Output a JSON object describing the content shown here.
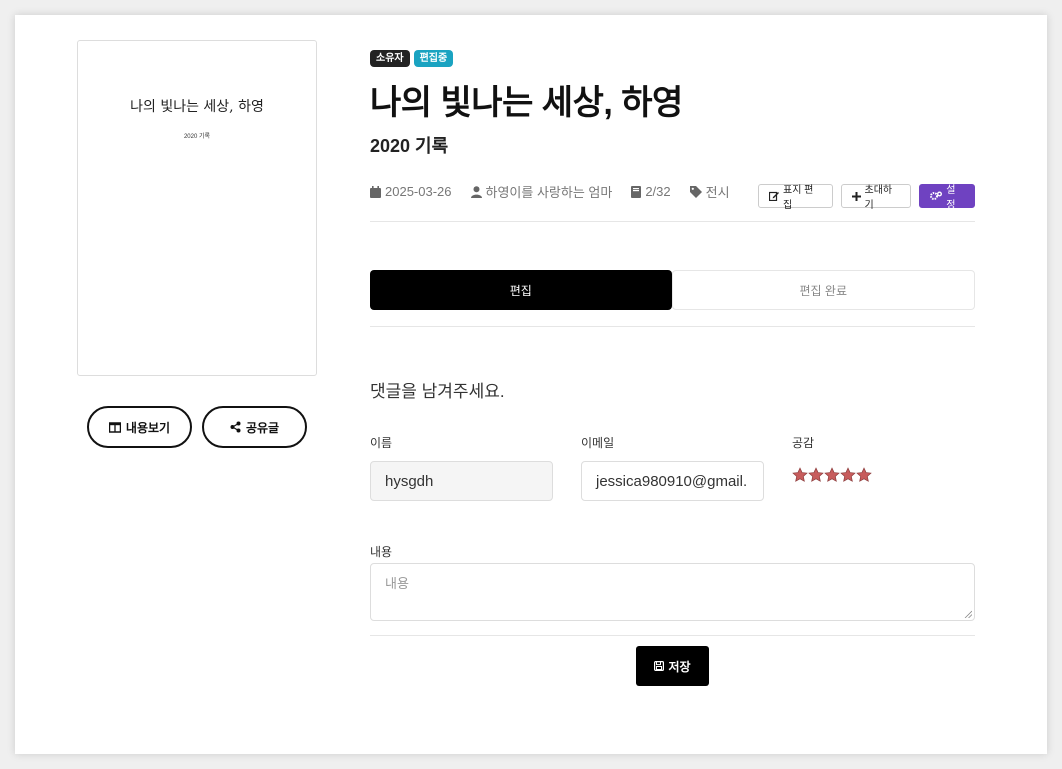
{
  "cover": {
    "title": "나의 빛나는 세상, 하영",
    "subtitle": "2020 기록"
  },
  "left_buttons": {
    "view_label": "내용보기",
    "share_label": "공유글"
  },
  "badges": {
    "owner": "소유자",
    "editing": "편집중"
  },
  "book": {
    "title": "나의 빛나는 세상, 하영",
    "subtitle": "2020 기록",
    "date": "2025-03-26",
    "author": "하영이를 사랑하는 엄마",
    "pages": "2/32",
    "tag": "전시"
  },
  "actions": {
    "edit_cover": "표지 편집",
    "invite": "초대하기",
    "settings": "설정"
  },
  "tabs": [
    {
      "label": "편집",
      "active": true
    },
    {
      "label": "편집 완료",
      "active": false
    }
  ],
  "comment": {
    "heading": "댓글을 남겨주세요.",
    "name_label": "이름",
    "name_value": "hysgdh",
    "email_label": "이메일",
    "email_value": "jessica980910@gmail.",
    "rating_label": "공감",
    "rating": 5,
    "rating_max": 5,
    "content_label": "내용",
    "content_placeholder": "내용",
    "save_label": "저장"
  },
  "colors": {
    "accent_purple": "#6f42c1",
    "badge_teal": "#1aa3c1",
    "star": "#c75c5c"
  }
}
